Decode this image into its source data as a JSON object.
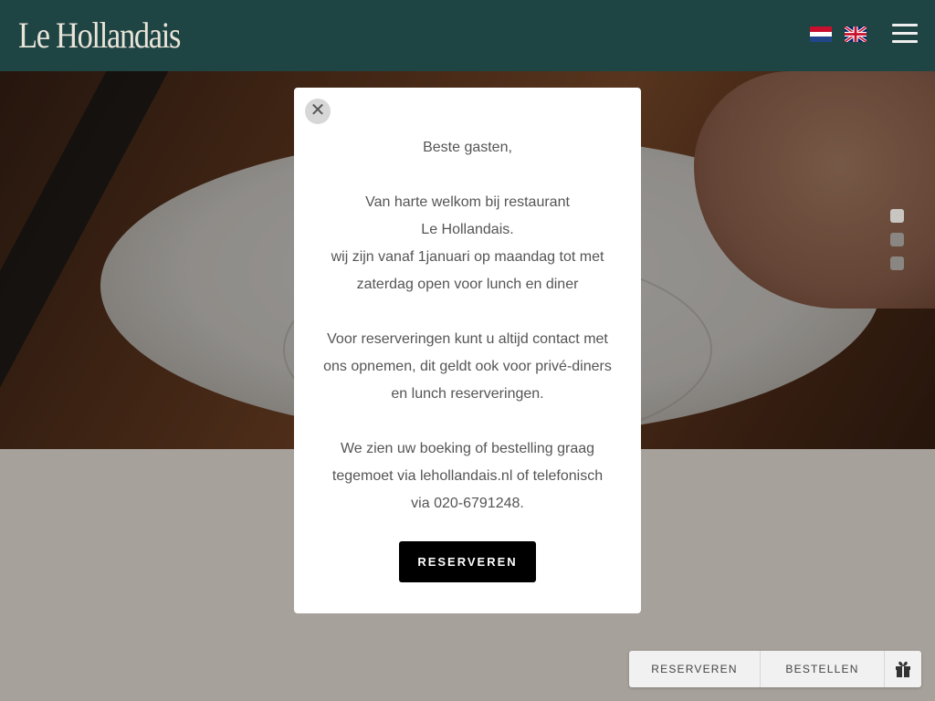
{
  "header": {
    "logo": "Le Hollandais",
    "languages": [
      {
        "code": "nl",
        "icon": "dutch-flag-icon"
      },
      {
        "code": "en",
        "icon": "uk-flag-icon"
      }
    ],
    "menu_icon": "hamburger-menu-icon"
  },
  "hero": {
    "slide_count": 3,
    "active_slide": 1
  },
  "modal": {
    "close_icon": "close-icon",
    "greeting": "Beste gasten,",
    "welcome_line1": "Van harte welkom bij restaurant",
    "welcome_line2": "Le Hollandais.",
    "welcome_line3": "wij zijn vanaf 1januari op maandag tot met",
    "welcome_line4": "zaterdag open voor lunch en diner",
    "reserve_line1": "Voor reserveringen kunt u altijd contact met",
    "reserve_line2": "ons opnemen, dit geldt ook voor privé-diners",
    "reserve_line3": "en lunch reserveringen.",
    "closing_line1": "We zien uw boeking of bestelling graag",
    "closing_line2": "tegemoet via lehollandais.nl of telefonisch",
    "closing_line3": "via 020-6791248.",
    "button_label": "RESERVEREN"
  },
  "action_bar": {
    "reserve_label": "RESERVEREN",
    "order_label": "BESTELLEN",
    "gift_icon": "gift-icon"
  },
  "colors": {
    "header_bg": "#1f4444",
    "modal_button": "#000000",
    "page_overlay": "#a6a19b"
  }
}
